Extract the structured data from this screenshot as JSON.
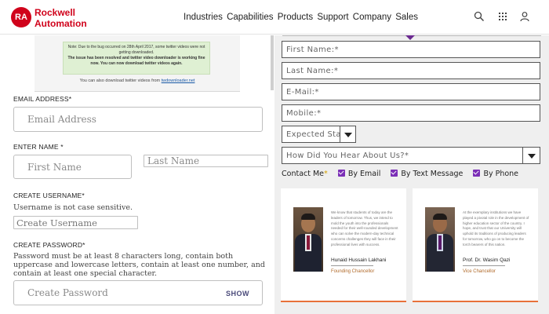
{
  "header": {
    "logo_badge": "RA",
    "logo_line1": "Rockwell",
    "logo_line2": "Automation",
    "nav": [
      "Industries",
      "Capabilities",
      "Products",
      "Support",
      "Company",
      "Sales"
    ],
    "brand_color": "#d0021b"
  },
  "notice": {
    "line1": "Note: Due to the bug occurred on 28th April 2017, some twitter videos were not getting downloaded.",
    "line2": "The issue has been resolved and twitter video downloader is working fine now. You can now download twitter videos again.",
    "footer_prefix": "You can also download twitter videos from",
    "footer_link": "twdownloader.net"
  },
  "form_left": {
    "email_label": "EMAIL ADDRESS*",
    "email_placeholder": "Email Address",
    "name_label": "ENTER NAME *",
    "first_name_placeholder": "First Name",
    "last_name_placeholder": "Last Name",
    "username_label": "CREATE USERNAME*",
    "username_hint": "Username is not case sensitive.",
    "username_placeholder": "Create Username",
    "password_label": "CREATE PASSWORD*",
    "password_hint": "Password must be at least 8 characters long, contain both uppercase and lowercase letters, contain at least one number, and contain at least one special character.",
    "password_placeholder": "Create Password",
    "show_label": "SHOW"
  },
  "form_right": {
    "first_name": "First Name:*",
    "last_name": "Last Name:*",
    "email": "E-Mail:*",
    "mobile": "Mobile:*",
    "start_year": "Expected Start Y",
    "hear_about": "How Did You Hear About Us?*",
    "contact_label": "Contact Me",
    "contact_req": "*",
    "options": [
      "By Email",
      "By Text Message",
      "By Phone"
    ],
    "accent_color": "#7b2fb6"
  },
  "cards": [
    {
      "text": "We know that students of today are the leaders of tomorrow. Thus, we intend to mold the youth into the professionals needed for their well-rounded development who can solve the modern-day technical concerns challenges they will face in their professional lives with success.",
      "name": "Hunaid Hussain Lakhani",
      "role": "Founding Chancellor"
    },
    {
      "text": "At the exemplary institutions we have played a pivotal role in the development of higher education sector of the country. I hope, and trust that our University will uphold its traditions of producing leaders for tomorrow, who go on to become the torch bearers of this nation.",
      "name": "Prof. Dr. Wasim Qazi",
      "role": "Vice Chancellor"
    }
  ]
}
